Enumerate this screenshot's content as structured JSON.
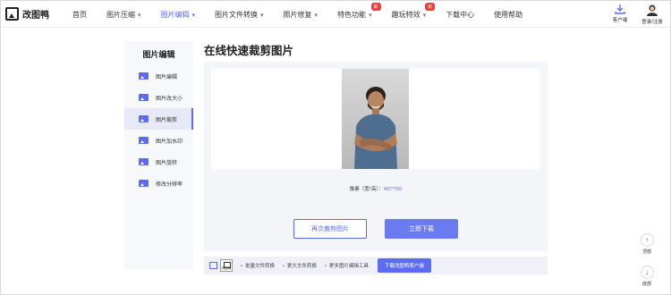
{
  "app": {
    "name": "改图鸭"
  },
  "nav": {
    "items": [
      {
        "label": "首页",
        "dropdown": false,
        "active": false,
        "badge": ""
      },
      {
        "label": "图片压缩",
        "dropdown": true,
        "active": false,
        "badge": ""
      },
      {
        "label": "图片编辑",
        "dropdown": true,
        "active": true,
        "badge": ""
      },
      {
        "label": "图片文件转换",
        "dropdown": true,
        "active": false,
        "badge": ""
      },
      {
        "label": "照片修复",
        "dropdown": true,
        "active": false,
        "badge": ""
      },
      {
        "label": "特色功能",
        "dropdown": true,
        "active": false,
        "badge": "新"
      },
      {
        "label": "趣玩特效",
        "dropdown": true,
        "active": false,
        "badge": "新"
      },
      {
        "label": "下载中心",
        "dropdown": false,
        "active": false,
        "badge": ""
      },
      {
        "label": "使用帮助",
        "dropdown": false,
        "active": false,
        "badge": ""
      }
    ],
    "client_label": "客户端",
    "login_label": "登录/注册"
  },
  "sidebar": {
    "title": "图片编辑",
    "items": [
      {
        "label": "图片编辑",
        "active": false
      },
      {
        "label": "图片改大小",
        "active": false
      },
      {
        "label": "图片裁剪",
        "active": true
      },
      {
        "label": "图片加水印",
        "active": false
      },
      {
        "label": "图片旋转",
        "active": false
      },
      {
        "label": "修改分辨率",
        "active": false
      }
    ]
  },
  "main": {
    "title": "在线快速裁剪图片",
    "pixel_label": "像素（宽*高）：",
    "pixel_value": "497*750",
    "recrop_label": "再次裁剪图片",
    "download_label": "立即下载"
  },
  "bottom": {
    "icon_caption": "改图鸭",
    "links": [
      "批量文件转换",
      "更大文件转换",
      "更多图片编辑工具"
    ],
    "download_client_label": "下载改图鸭客户端"
  },
  "float": {
    "top_label": "顶部",
    "bottom_label": "底部"
  },
  "colors": {
    "accent": "#5b6cf0",
    "badge": "#f23a3a"
  }
}
